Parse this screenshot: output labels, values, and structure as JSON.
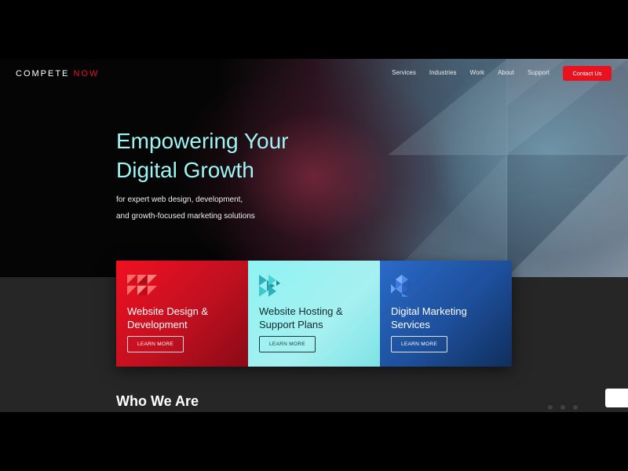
{
  "header": {
    "logo": {
      "main": "Compete ",
      "accent": "Now"
    },
    "nav": [
      "Services",
      "Industries",
      "Work",
      "About",
      "Support"
    ],
    "cta_label": "Contact Us"
  },
  "hero": {
    "title_line1": "Empowering Your",
    "title_line2": "Digital Growth",
    "subtitle_line1": "for expert web design, development,",
    "subtitle_line2": "and growth-focused marketing solutions"
  },
  "cards": [
    {
      "title": "Website Design & Development",
      "button": "LEARN MORE",
      "icon": "triangle-grid-icon"
    },
    {
      "title": "Website Hosting & Support Plans",
      "button": "LEARN MORE",
      "icon": "chevron-triangles-icon"
    },
    {
      "title": "Digital Marketing Services",
      "button": "LEARN MORE",
      "icon": "diamond-triangles-icon"
    }
  ],
  "section": {
    "heading": "Who We Are"
  },
  "colors": {
    "accent": "#e8131f",
    "cyan": "#9ff4f4",
    "blue": "#2a6ac8",
    "dark": "#262626"
  }
}
